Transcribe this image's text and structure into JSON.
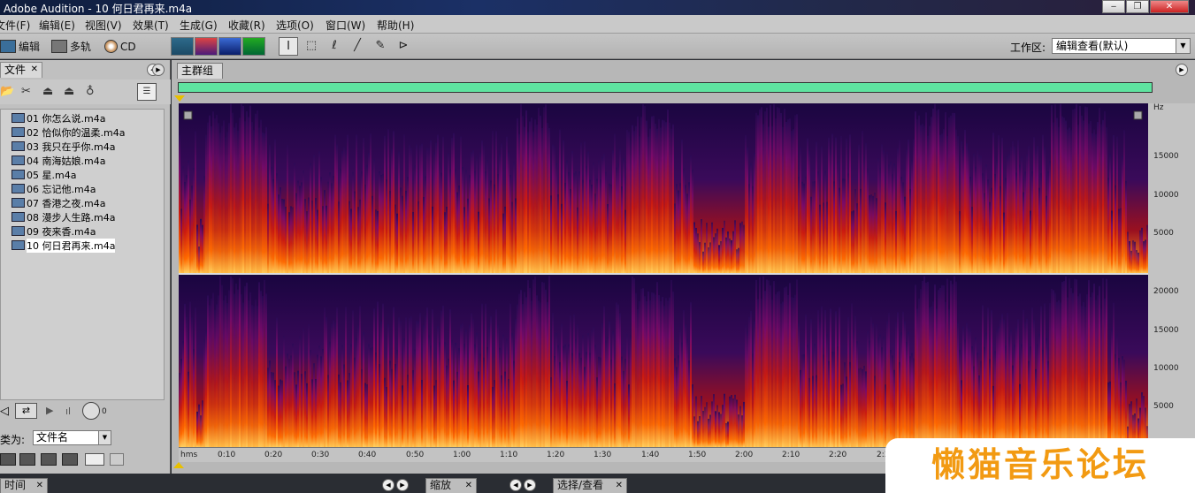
{
  "window": {
    "title": "Adobe Audition - 10 何日君再来.m4a"
  },
  "menu": [
    "文件(F)",
    "编辑(E)",
    "视图(V)",
    "效果(T)",
    "生成(G)",
    "收藏(R)",
    "选项(O)",
    "窗口(W)",
    "帮助(H)"
  ],
  "toolbar": {
    "edit_label": "编辑",
    "multitrack_label": "多轨",
    "cd_label": "CD",
    "workspace_label": "工作区:",
    "workspace_value": "编辑查看(默认)"
  },
  "files_panel": {
    "tab_label": "文件",
    "items": [
      "01 你怎么说.m4a",
      "02 恰似你的温柔.m4a",
      "03 我只在乎你.m4a",
      "04 南海姑娘.m4a",
      "05 星.m4a",
      "06 忘记他.m4a",
      "07 香港之夜.m4a",
      "08 漫步人生路.m4a",
      "09 夜来香.m4a",
      "10 何日君再来.m4a"
    ],
    "selected_index": 9,
    "sort_label": "类为:",
    "sort_value": "文件名"
  },
  "main": {
    "tab_label": "主群组",
    "hz_unit": "Hz",
    "hz_ticks_top": [
      "15000",
      "10000",
      "5000"
    ],
    "hz_ticks_bottom": [
      "20000",
      "15000",
      "10000",
      "5000"
    ],
    "time_ticks": [
      "hms",
      "0:10",
      "0:20",
      "0:30",
      "0:40",
      "0:50",
      "1:00",
      "1:10",
      "1:20",
      "1:30",
      "1:40",
      "1:50",
      "2:00",
      "2:10",
      "2:20",
      "2:3"
    ]
  },
  "lower_tabs": [
    "时间",
    "缩放",
    "选择/查看"
  ],
  "watermark": "懒猫音乐论坛",
  "colors": {
    "overview": "#5fe3a0",
    "spectrum_hot": "#ff6a00",
    "spectrum_cold": "#15093a"
  }
}
